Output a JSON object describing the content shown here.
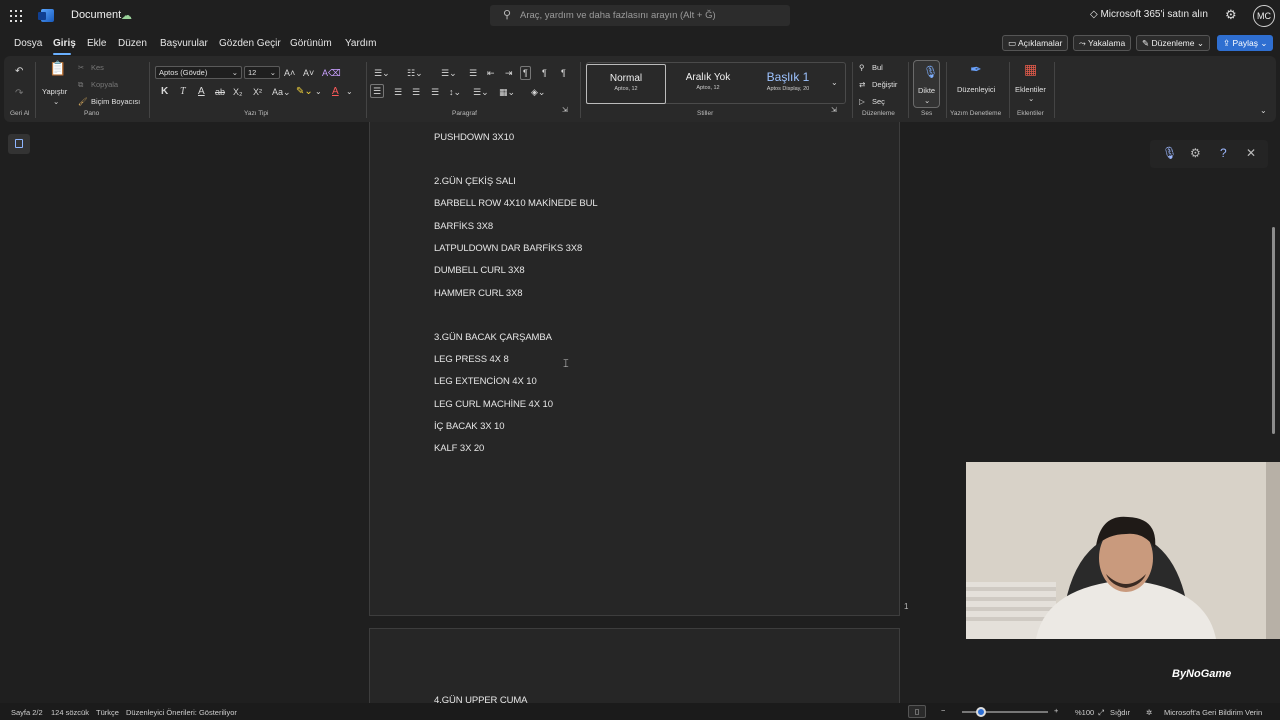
{
  "titlebar": {
    "doc_title": "Document",
    "search_placeholder": "Araç, yardım ve daha fazlasını arayın (Alt + Ğ)",
    "buy_label": "Microsoft 365'i satın alın",
    "avatar_initials": "MC"
  },
  "menu": {
    "tabs": [
      "Dosya",
      "Giriş",
      "Ekle",
      "Düzen",
      "Başvurular",
      "Gözden Geçir",
      "Görünüm",
      "Yardım"
    ],
    "active_tab": "Giriş",
    "comments_label": "Açıklamalar",
    "catchup_label": "Yakalama",
    "editing_label": "Düzenleme",
    "share_label": "Paylaş"
  },
  "ribbon": {
    "undo_group": "Geri Al",
    "clipboard": {
      "paste": "Yapıştır",
      "cut": "Kes",
      "copy": "Kopyala",
      "format_painter": "Biçim Boyacısı",
      "group": "Pano"
    },
    "font": {
      "name": "Aptos (Gövde)",
      "size": "12",
      "group": "Yazı Tipi",
      "bold": "K",
      "italic": "T"
    },
    "paragraph_group": "Paragraf",
    "styles": {
      "items": [
        {
          "name": "Normal",
          "sub": "Aptos, 12"
        },
        {
          "name": "Aralık Yok",
          "sub": "Aptos, 12"
        },
        {
          "name": "Başlık 1",
          "sub": "Aptos Display, 20"
        }
      ],
      "group": "Stiller"
    },
    "editing": {
      "find": "Bul",
      "replace": "Değiştir",
      "select": "Seç",
      "group": "Düzenleme"
    },
    "voice": {
      "dictate": "Dikte",
      "group": "Ses"
    },
    "editor": {
      "label": "Düzenleyici",
      "group": "Yazım Denetleme"
    },
    "addins": {
      "label": "Eklentiler",
      "group": "Eklentiler"
    }
  },
  "document": {
    "page1_lines": [
      "PUSHDOWN 3X10",
      "",
      "2.GÜN ÇEKİŞ SALI",
      "BARBELL ROW 4X10 MAKİNEDE BUL",
      "BARFİKS 3X8",
      "LATPULDOWN DAR BARFİKS 3X8",
      "DUMBELL CURL 3X8",
      "HAMMER CURL 3X8",
      "",
      "3.GÜN BACAK ÇARŞAMBA",
      "LEG PRESS 4X 8",
      "LEG EXTENCİON 4X 10",
      "LEG CURL MACHİNE 4X 10",
      "İÇ BACAK 3X 10",
      "KALF 3X 20"
    ],
    "page_number": "1",
    "page2_lines": [
      "4.GÜN UPPER CUMA"
    ]
  },
  "watermark": "ByNoGame",
  "status": {
    "page": "Sayfa 2/2",
    "words": "124 sözcük",
    "language": "Türkçe",
    "editor_suggestions": "Düzenleyici Önerileri: Gösteriliyor",
    "zoom": "%100",
    "fit": "Sığdır",
    "feedback": "Microsoft'a Geri Bildirim Verin"
  }
}
